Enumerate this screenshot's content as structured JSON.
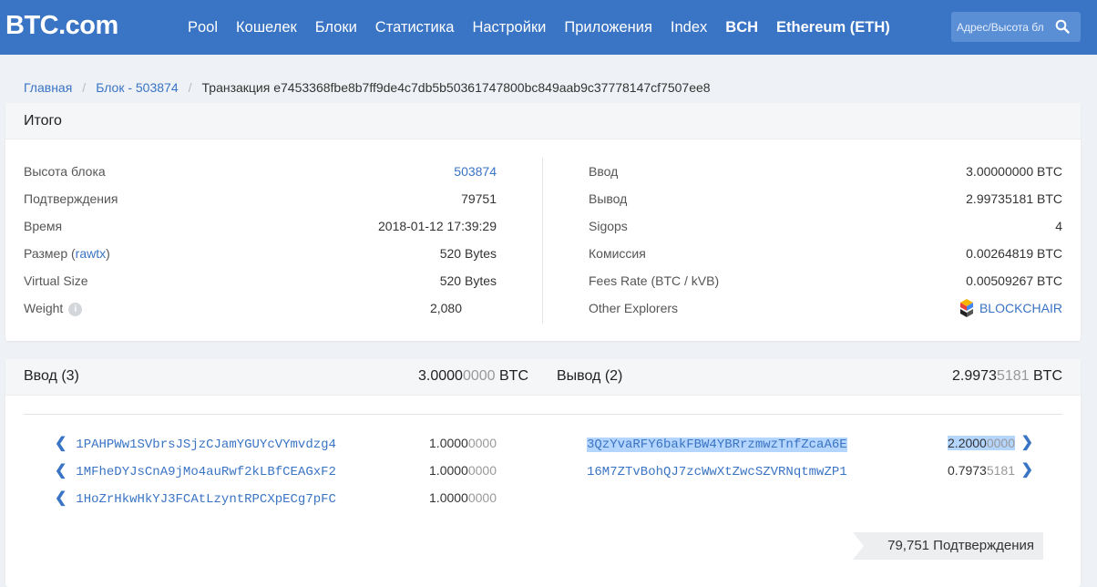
{
  "header": {
    "logo": "BTC.com",
    "nav": [
      "Pool",
      "Кошелек",
      "Блоки",
      "Статистика",
      "Настройки",
      "Приложения",
      "Index",
      "BCH",
      "Ethereum (ETH)"
    ],
    "search_placeholder": "Адрес/Высота бл"
  },
  "breadcrumb": {
    "home": "Главная",
    "block": "Блок - 503874",
    "current": "Транзакция e7453368fbe8b7ff9de4c7db5b50361747800bc849aab9c37778147cf7507ee8"
  },
  "summary": {
    "title": "Итого",
    "left": [
      {
        "label": "Высота блока",
        "value": "503874"
      },
      {
        "label": "Подтверждения",
        "value": "79751"
      },
      {
        "label": "Время",
        "value": "2018-01-12 17:39:29"
      },
      {
        "label_prefix": "Размер (",
        "label_link": "rawtx",
        "label_suffix": ")",
        "value": "520 Bytes"
      },
      {
        "label": "Virtual Size",
        "value": "520 Bytes"
      },
      {
        "label": "Weight",
        "value": "2,080"
      }
    ],
    "right": [
      {
        "label": "Ввод",
        "value": "3.00000000 BTC"
      },
      {
        "label": "Вывод",
        "value": "2.99735181 BTC"
      },
      {
        "label": "Sigops",
        "value": "4"
      },
      {
        "label": "Комиссия",
        "value": "0.00264819 BTC"
      },
      {
        "label": "Fees Rate (BTC / kVB)",
        "value": "0.00509267 BTC"
      },
      {
        "label": "Other Explorers",
        "value": "BLOCKCHAIR"
      }
    ]
  },
  "io": {
    "inputs_title": "Ввод (3)",
    "inputs_total_main": "3.0000",
    "inputs_total_faded": "0000",
    "inputs_total_unit": " BTC",
    "outputs_title": "Вывод (2)",
    "outputs_total_main": "2.9973",
    "outputs_total_faded": "5181",
    "outputs_total_unit": " BTC",
    "inputs": [
      {
        "address": "1PAHPWw1SVbrsJSjzCJamYGUYcVYmvdzg4",
        "amount_main": "1.0000",
        "amount_faded": "0000"
      },
      {
        "address": "1MFheDYJsCnA9jMo4auRwf2kLBfCEAGxF2",
        "amount_main": "1.0000",
        "amount_faded": "0000"
      },
      {
        "address": "1HoZrHkwHkYJ3FCAtLzyntRPCXpECg7pFC",
        "amount_main": "1.0000",
        "amount_faded": "0000"
      }
    ],
    "outputs": [
      {
        "address": "3QzYvaRFY6bakFBW4YBRrzmwzTnfZcaA6E",
        "amount_main": "2.2000",
        "amount_faded": "0000"
      },
      {
        "address": "16M7ZTvBohQJ7zcWwXtZwcSZVRNqtmwZP1",
        "amount_main": "0.7973",
        "amount_faded": "5181"
      }
    ],
    "confirmations": "79,751 Подтверждения"
  }
}
